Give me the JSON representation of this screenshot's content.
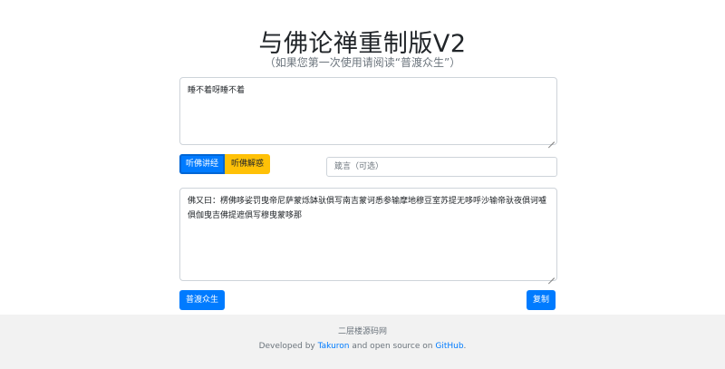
{
  "header": {
    "title": "与佛论禅重制版V2",
    "subtitle": "（如果您第一次使用请阅读“普渡众生”）"
  },
  "input": {
    "value": "睡不着呀睡不着"
  },
  "buttons": {
    "listen": "听佛讲经",
    "decode": "听佛解惑",
    "save": "普渡众生",
    "copy": "复制"
  },
  "key_input": {
    "placeholder": "箴言（可选）"
  },
  "output": {
    "value": "佛又曰：楞佛哆娑罚曳帝尼萨蒙烁缽驮俱写南吉蒙诃悉参输摩地穆豆室苏提无哆呼沙输帝驮夜俱诃嚧俱伽曳吉佛提遮俱写穆曳蒙哆那"
  },
  "footer": {
    "site": "二层楼源码网",
    "developed_by": "Developed by",
    "author": "Takuron",
    "open_source": "and open source on",
    "github": "GitHub",
    "period": "."
  },
  "colors": {
    "primary": "#007bff",
    "warning": "#ffc107",
    "footer_bg": "#f2f2f2"
  }
}
